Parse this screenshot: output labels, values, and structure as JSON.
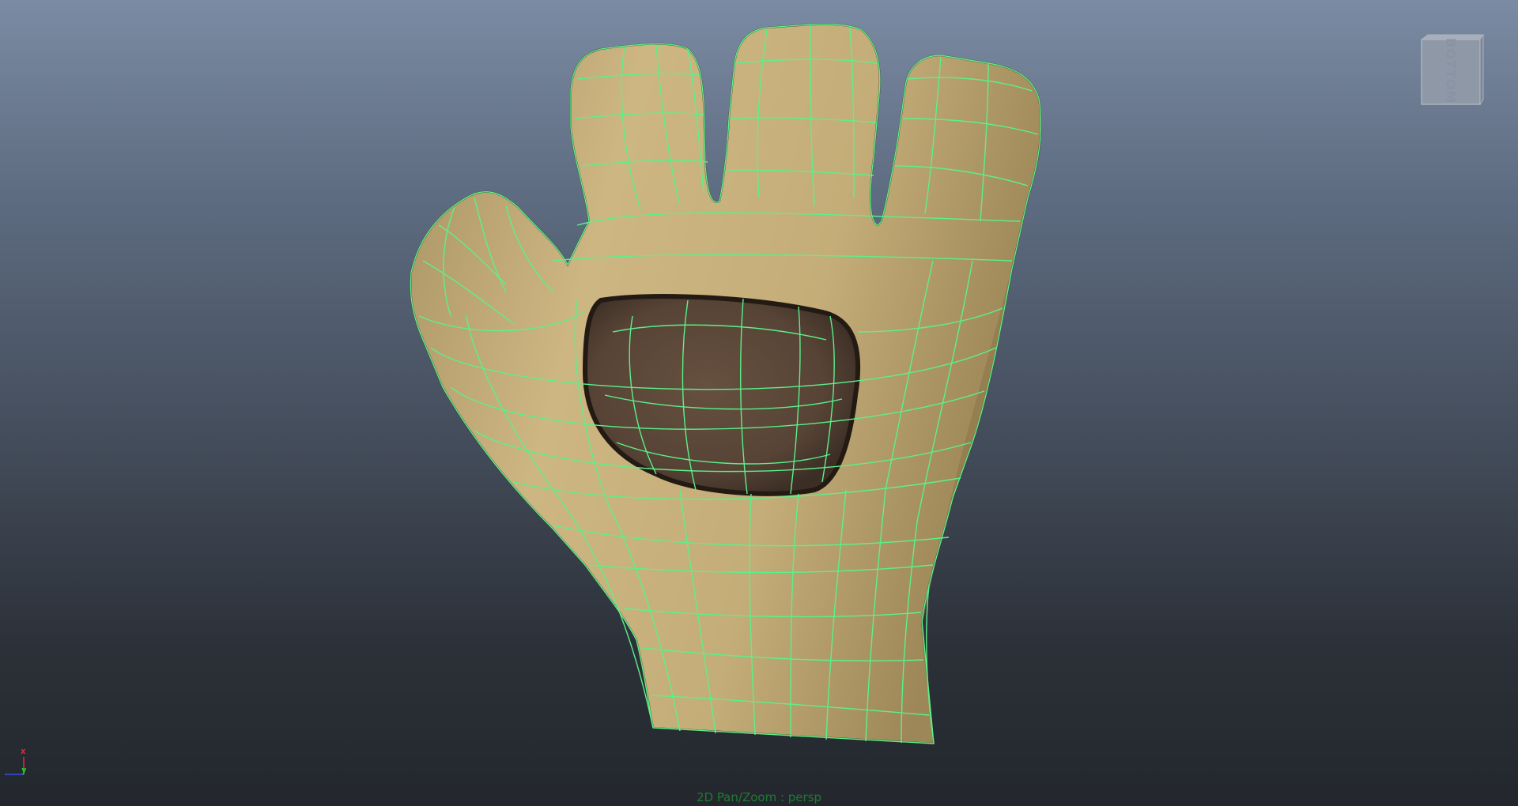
{
  "viewport": {
    "camera": "persp",
    "background_top": "#7b8ba3",
    "background_bottom": "#23272d"
  },
  "viewcube": {
    "face_label": "BOTTOM",
    "fill_color": "#9aa3b1"
  },
  "axis_gizmo": {
    "x_label": "x",
    "y_label": "y",
    "x_color": "#e03030",
    "y_color": "#30c030",
    "z_color": "#3050e0"
  },
  "hud": {
    "status_text": "2D Pan/Zoom : persp",
    "status_color": "#1f7a33"
  },
  "model": {
    "name": "glove",
    "skin_color": "#c9b27a",
    "palm_patch_color": "#5a463a",
    "wireframe_color": "#5cf08a",
    "selection_state": "selected"
  }
}
